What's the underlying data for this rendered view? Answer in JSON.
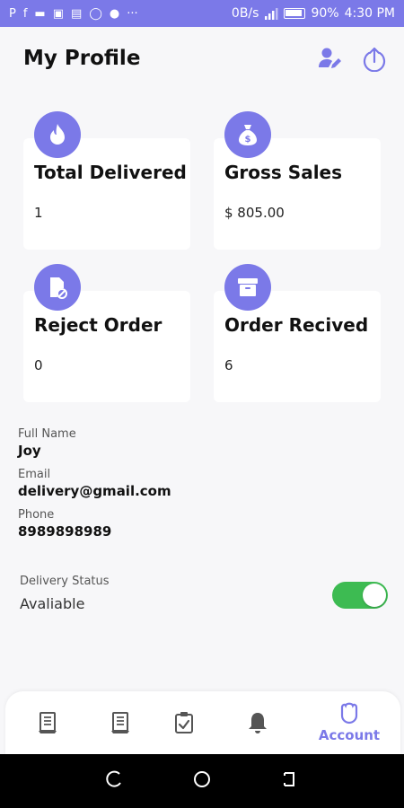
{
  "status_bar": {
    "left_glyphs": [
      "P",
      "f",
      "▬",
      "▣",
      "▤",
      "◯",
      "●",
      "···"
    ],
    "net_speed": "0B/s",
    "battery": "90%",
    "time": "4:30 PM"
  },
  "header": {
    "title": "My Profile",
    "icons": [
      "edit-profile-icon",
      "logout-icon"
    ]
  },
  "stats": [
    {
      "label": "Total Delivered",
      "value": "1",
      "icon": "flame-icon"
    },
    {
      "label": "Gross Sales",
      "value": "$ 805.00",
      "icon": "money-bag-icon"
    },
    {
      "label": "Reject Order",
      "value": "0",
      "icon": "rejected-document-icon"
    },
    {
      "label": "Order Recived",
      "value": "6",
      "icon": "archive-box-icon"
    }
  ],
  "profile": {
    "name_label": "Full Name",
    "name": "Joy",
    "email_label": "Email",
    "email": "delivery@gmail.com",
    "phone_label": "Phone",
    "phone": "8989898989"
  },
  "delivery_status": {
    "label": "Delivery Status",
    "value": "Avaliable",
    "toggle_on": true
  },
  "bottom_nav": {
    "items": [
      {
        "icon": "orders-list-icon"
      },
      {
        "icon": "orders-history-icon"
      },
      {
        "icon": "clipboard-check-icon"
      },
      {
        "icon": "bell-icon"
      },
      {
        "icon": "account-icon",
        "label": "Account",
        "active": true
      }
    ]
  },
  "colors": {
    "accent": "#7b79e8",
    "toggle_on": "#3dbb52",
    "background": "#f7f7f9"
  }
}
